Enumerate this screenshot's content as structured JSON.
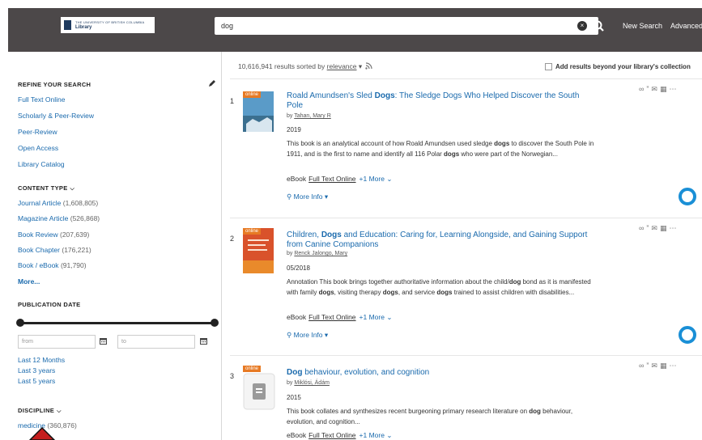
{
  "header": {
    "logo_line1": "THE UNIVERSITY OF BRITISH COLUMBIA",
    "logo_line2": "Library",
    "search_value": "dog",
    "clear_glyph": "×",
    "new_search": "New Search",
    "advanced": "Advanced"
  },
  "sidebar": {
    "refine_title": "REFINE YOUR SEARCH",
    "refine_links": [
      "Full Text Online",
      "Scholarly & Peer-Review",
      "Peer-Review",
      "Open Access",
      "Library Catalog"
    ],
    "content_type_title": "CONTENT TYPE",
    "content_types": [
      {
        "label": "Journal Article",
        "count": "(1,608,805)"
      },
      {
        "label": "Magazine Article",
        "count": "(526,868)"
      },
      {
        "label": "Book Review",
        "count": "(207,639)"
      },
      {
        "label": "Book Chapter",
        "count": "(176,221)"
      },
      {
        "label": "Book / eBook",
        "count": "(91,790)"
      }
    ],
    "more": "More...",
    "pub_date_title": "PUBLICATION DATE",
    "from_placeholder": "from",
    "to_placeholder": "to",
    "date_links": [
      "Last 12 Months",
      "Last 3 years",
      "Last 5 years"
    ],
    "discipline_title": "DISCIPLINE",
    "disciplines": [
      {
        "label": "medicine",
        "count": "(360,876)"
      }
    ]
  },
  "main": {
    "results_prefix": "10,616,941 results sorted by",
    "sort_value": "relevance",
    "add_results": "Add results beyond your library's collection",
    "online_tag": "online",
    "more_info": "More Info",
    "results": [
      {
        "num": "1",
        "title_pre": "Roald Amundsen's Sled ",
        "title_bold": "Dogs",
        "title_post": ": The Sledge Dogs Who Helped Discover the South Pole",
        "by": "by",
        "author": "Tahan, Mary R",
        "date": "2019",
        "snippet_parts": [
          "This book is an analytical account of how Roald Amundsen used sledge ",
          "dogs",
          " to discover the South Pole in 1911, and is the first to name and identify all 116 Polar ",
          "dogs",
          " who were part of the Norwegian..."
        ],
        "format": "eBook",
        "full_text": "Full Text Online",
        "more": "+1 More"
      },
      {
        "num": "2",
        "title_pre": "Children, ",
        "title_bold": "Dogs",
        "title_post": " and Education: Caring for, Learning Alongside, and Gaining Support from Canine Companions",
        "by": "by",
        "author": "Renck Jalongo, Mary",
        "date": "05/2018",
        "snippet_parts": [
          "Annotation This book brings together authoritative information about the child/",
          "dog",
          " bond as it is manifested with family ",
          "dogs",
          ", visiting therapy ",
          "dogs",
          ", and service ",
          "dogs",
          " trained to assist children with disabilities..."
        ],
        "format": "eBook",
        "full_text": "Full Text Online",
        "more": "+1 More"
      },
      {
        "num": "3",
        "title_pre": "",
        "title_bold": "Dog",
        "title_post": " behaviour, evolution, and cognition",
        "by": "by",
        "author": "Miklósi, Ádám",
        "date": "2015",
        "snippet_parts": [
          "This book collates and synthesizes recent burgeoning primary research literature on ",
          "dog",
          " behaviour, evolution, and cognition..."
        ],
        "format": "eBook",
        "full_text": "Full Text Online",
        "more": "+1 More"
      }
    ]
  },
  "colors": {
    "header_bg": "#4c4849",
    "link": "#1a6aad",
    "online_tag": "#e77a24",
    "ring": "#1a8fd6"
  }
}
